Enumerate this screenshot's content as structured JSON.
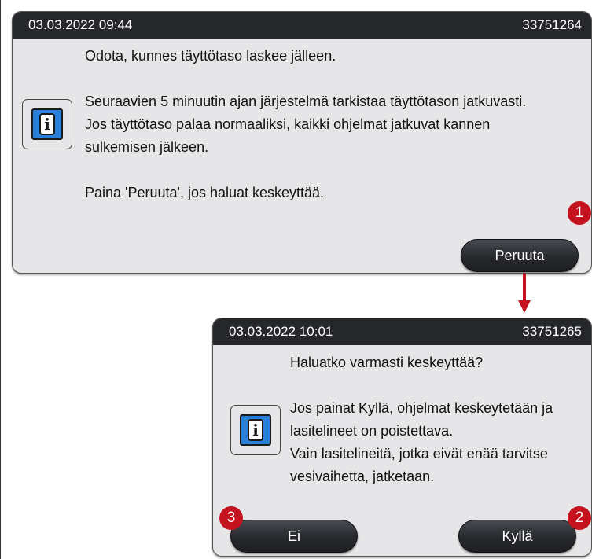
{
  "dialog1": {
    "timestamp": "03.03.2022 09:44",
    "message_id": "33751264",
    "heading": "Odota, kunnes täyttötaso laskee jälleen.",
    "body_lines": [
      "Seuraavien 5 minuutin ajan järjestelmä tarkistaa täyttötason jatkuvasti.",
      "Jos täyttötaso palaa normaaliksi, kaikki ohjelmat jatkuvat kannen",
      "sulkemisen jälkeen."
    ],
    "instruction": "Paina 'Peruuta', jos haluat keskeyttää.",
    "cancel_label": "Peruuta",
    "info_glyph": "i"
  },
  "dialog2": {
    "timestamp": "03.03.2022 10:01",
    "message_id": "33751265",
    "heading": "Haluatko varmasti keskeyttää?",
    "body_lines": [
      "Jos painat Kyllä, ohjelmat keskeytetään ja",
      "lasitelineet on poistettava.",
      "Vain lasitelineitä, jotka eivät enää tarvitse",
      "vesivaihetta, jatketaan."
    ],
    "no_label": "Ei",
    "yes_label": "Kyllä",
    "info_glyph": "i"
  },
  "callouts": [
    "1",
    "2",
    "3"
  ],
  "colors": {
    "titlebar": "#25272b",
    "dialog_background": "#e6e6e8",
    "button": "#26282c",
    "info_icon": "#2a7fd8",
    "callout": "#c4121f",
    "arrow": "#c4121f"
  },
  "icons": {
    "info": "info-icon",
    "arrow": "arrow-down-icon"
  }
}
